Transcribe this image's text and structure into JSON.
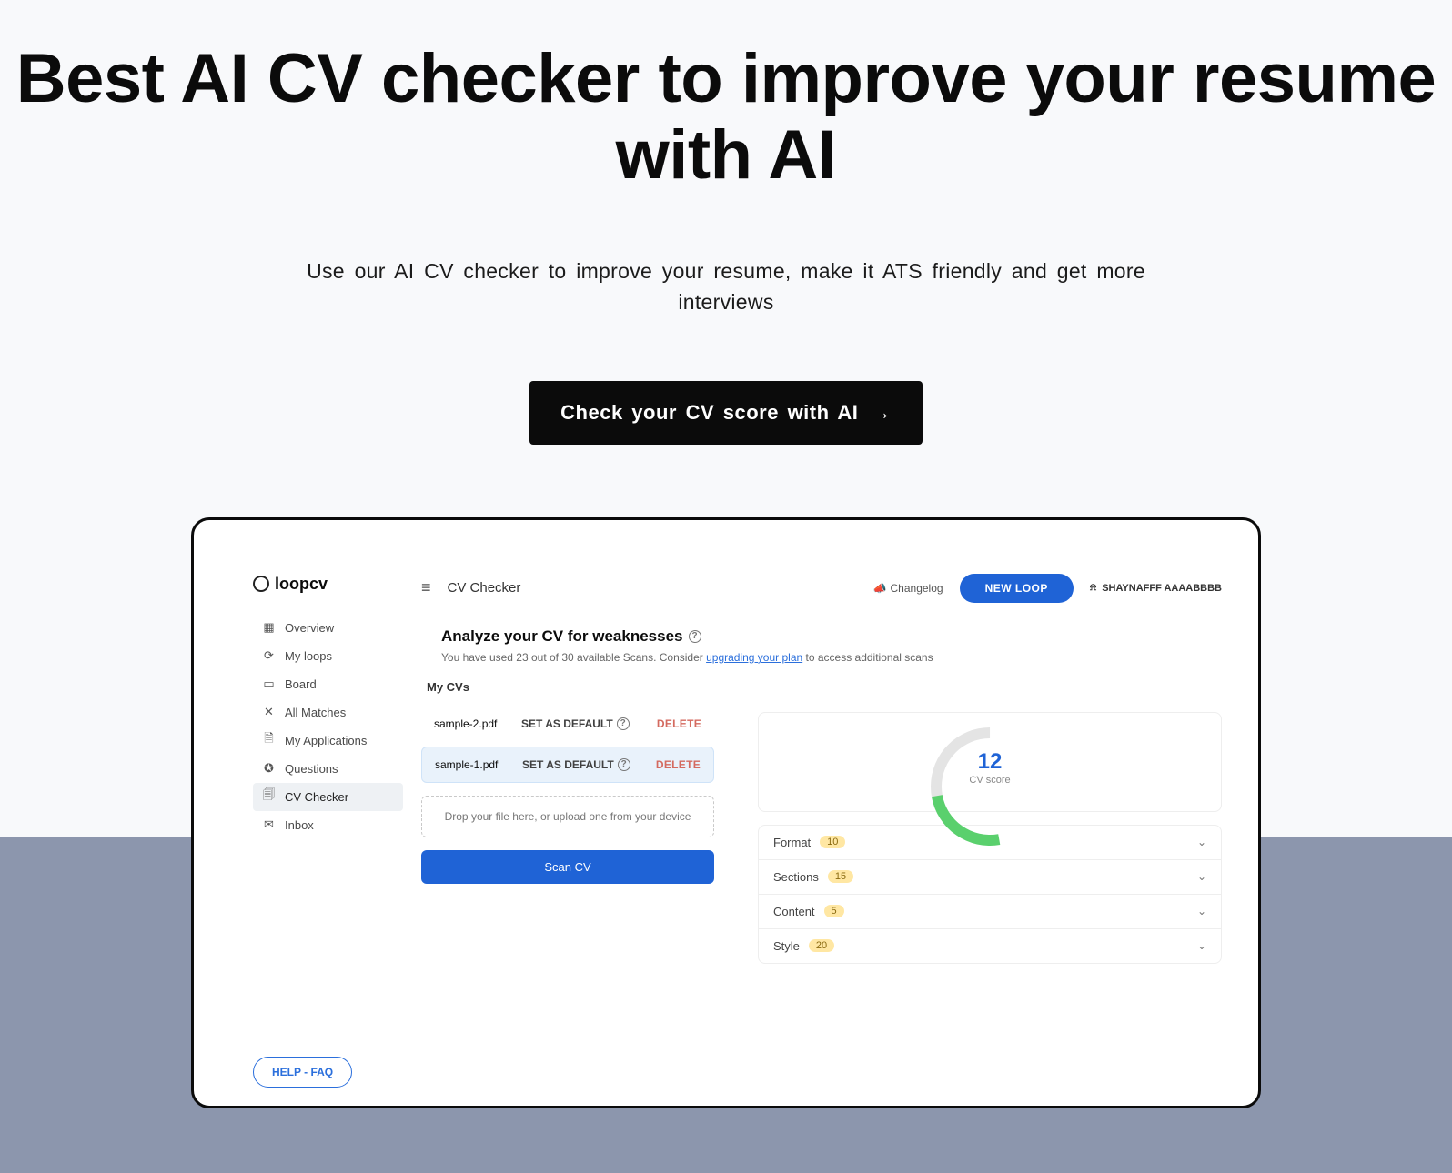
{
  "hero": {
    "title": "Best AI CV checker to improve your resume with AI",
    "subtitle": "Use our AI CV checker to improve your resume, make it ATS friendly and get more interviews",
    "cta": "Check your CV score with AI"
  },
  "app": {
    "brand": "loopcv",
    "nav": [
      {
        "label": "Overview"
      },
      {
        "label": "My loops"
      },
      {
        "label": "Board"
      },
      {
        "label": "All Matches"
      },
      {
        "label": "My Applications"
      },
      {
        "label": "Questions"
      },
      {
        "label": "CV Checker"
      },
      {
        "label": "Inbox"
      }
    ],
    "active_nav_index": 6,
    "help_btn": "HELP - FAQ",
    "topbar": {
      "page_title": "CV Checker",
      "changelog": "Changelog",
      "new_loop": "NEW LOOP",
      "user_name": "SHAYNAFFF AAAABBBB"
    },
    "analyze": {
      "title": "Analyze your CV for weaknesses",
      "sub_prefix": "You have used 23 out of 30 available Scans. Consider ",
      "sub_link": "upgrading your plan",
      "sub_suffix": " to access additional scans",
      "mycvs_label": "My CVs"
    },
    "cvs": [
      {
        "filename": "sample-2.pdf",
        "set_default": "SET AS DEFAULT",
        "delete": "DELETE",
        "selected": false
      },
      {
        "filename": "sample-1.pdf",
        "set_default": "SET AS DEFAULT",
        "delete": "DELETE",
        "selected": true
      }
    ],
    "dropzone": "Drop your file here, or upload one from your device",
    "scan_btn": "Scan CV",
    "score": {
      "value": "12",
      "label": "CV score"
    },
    "accordion": [
      {
        "label": "Format",
        "badge": "10"
      },
      {
        "label": "Sections",
        "badge": "15"
      },
      {
        "label": "Content",
        "badge": "5"
      },
      {
        "label": "Style",
        "badge": "20"
      }
    ]
  }
}
